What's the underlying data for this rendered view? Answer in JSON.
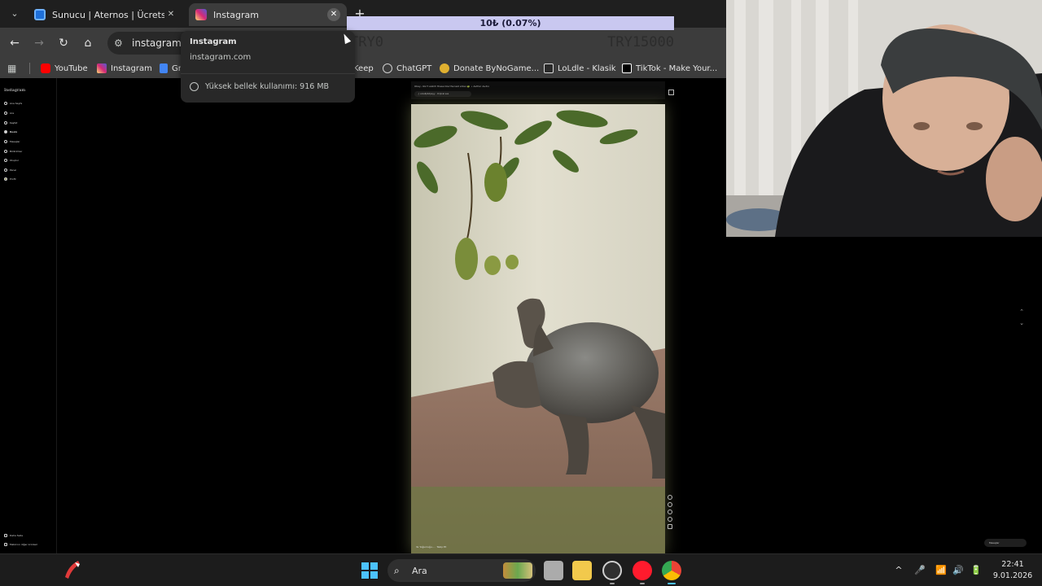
{
  "tabs": [
    {
      "title": "Sunucu | Aternos | Ücretsiz Minecraft",
      "close": "✕"
    },
    {
      "title": "Instagram",
      "close": "✕"
    }
  ],
  "tab_search_icon": "⌄",
  "new_tab": "+",
  "nav": {
    "back": "←",
    "forward": "→",
    "reload": "↻",
    "home": "⌂"
  },
  "omnibox": {
    "tune_icon": "⚙",
    "url": "instagram.com"
  },
  "bookmarks": [
    {
      "label": "YouTube",
      "color": "#ff0000"
    },
    {
      "label": "Instagram",
      "color": "#d62976"
    },
    {
      "label": "Gr",
      "color": "#4285f4"
    },
    {
      "label": "Keep",
      "color": "#fbbc04"
    },
    {
      "label": "ChatGPT",
      "color": "#cfcfcf"
    },
    {
      "label": "Donate ByNoGame...",
      "color": "#e0b030"
    },
    {
      "label": "LoLdle - Klasik",
      "color": "#d8d8d8"
    },
    {
      "label": "TikTok - Make Your...",
      "color": "#ffffff"
    }
  ],
  "ticker": {
    "amount": "10₺ (0.07%)",
    "left": "TRY0",
    "right": "TRY15000"
  },
  "hovercard": {
    "title": "Instagram",
    "url": "instagram.com",
    "memory": "Yüksek bellek kullanımı: 916 MB"
  },
  "instagram": {
    "logo": "Instagram",
    "nav_items": [
      "Ana Sayfa",
      "Ara",
      "Keşfet",
      "Reels",
      "Mesajlar",
      "Bildirimler",
      "Oluştur",
      "Panel",
      "Profil"
    ],
    "bottom_items": [
      "Daha fazla",
      "Meta'nın diğer ürünleri"
    ],
    "reel_header_line": "Okay, don't watch these like the last video 🐢 • Author Audio",
    "reel_header_pill": "♫ aniallpbdpeyy · Orijinal ses",
    "reel_caption": "Ya Yoğunluğu... · Takip Et",
    "messages_pill": "Mesajlar"
  },
  "scroll": {
    "up": "⌃",
    "down": "⌄"
  },
  "taskbar": {
    "search_label": "Ara",
    "tray_chevron": "^",
    "tray_mic": "🎤",
    "tray_wifi": "📶",
    "tray_volume": "🔊",
    "tray_battery": "🔋",
    "time": "22:41",
    "date": "9.01.2026"
  }
}
